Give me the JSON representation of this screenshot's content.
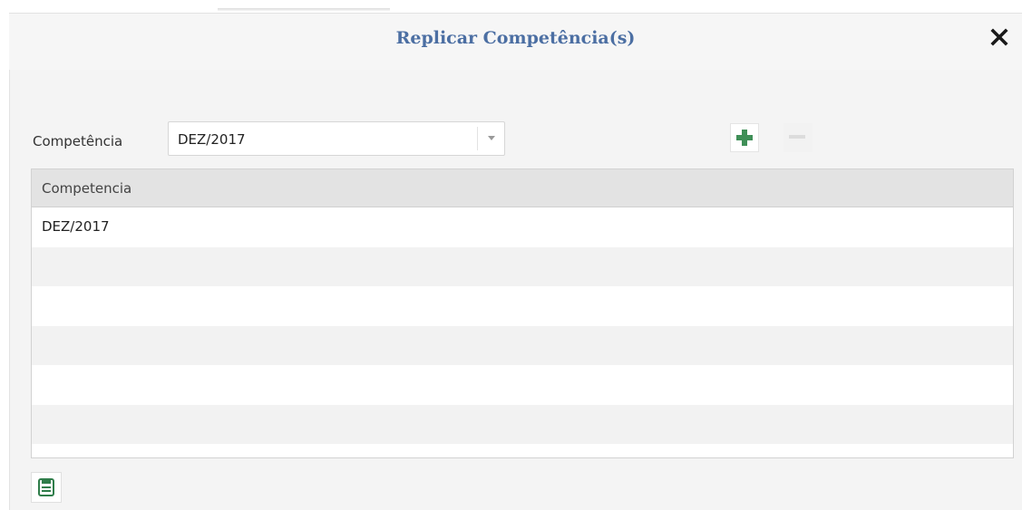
{
  "dialog": {
    "title": "Replicar Competência(s)",
    "close_icon": "close-icon"
  },
  "form": {
    "field_label": "Competência",
    "combo_value": "DEZ/2017",
    "dropdown_icon": "chevron-down-icon",
    "add_icon": "plus-icon",
    "remove_icon": "minus-icon",
    "add_enabled": true,
    "remove_enabled": false
  },
  "grid": {
    "column_header": "Competencia",
    "rows": [
      "DEZ/2017",
      "",
      "",
      "",
      "",
      "",
      ""
    ]
  },
  "footer": {
    "save_icon": "save-icon"
  },
  "colors": {
    "title": "#4c6fa3",
    "add_icon": "#3f8f57",
    "save_icon": "#2f7d4a",
    "grid_header_bg": "#e3e3e3",
    "row_alt_bg": "#f2f2f2"
  }
}
